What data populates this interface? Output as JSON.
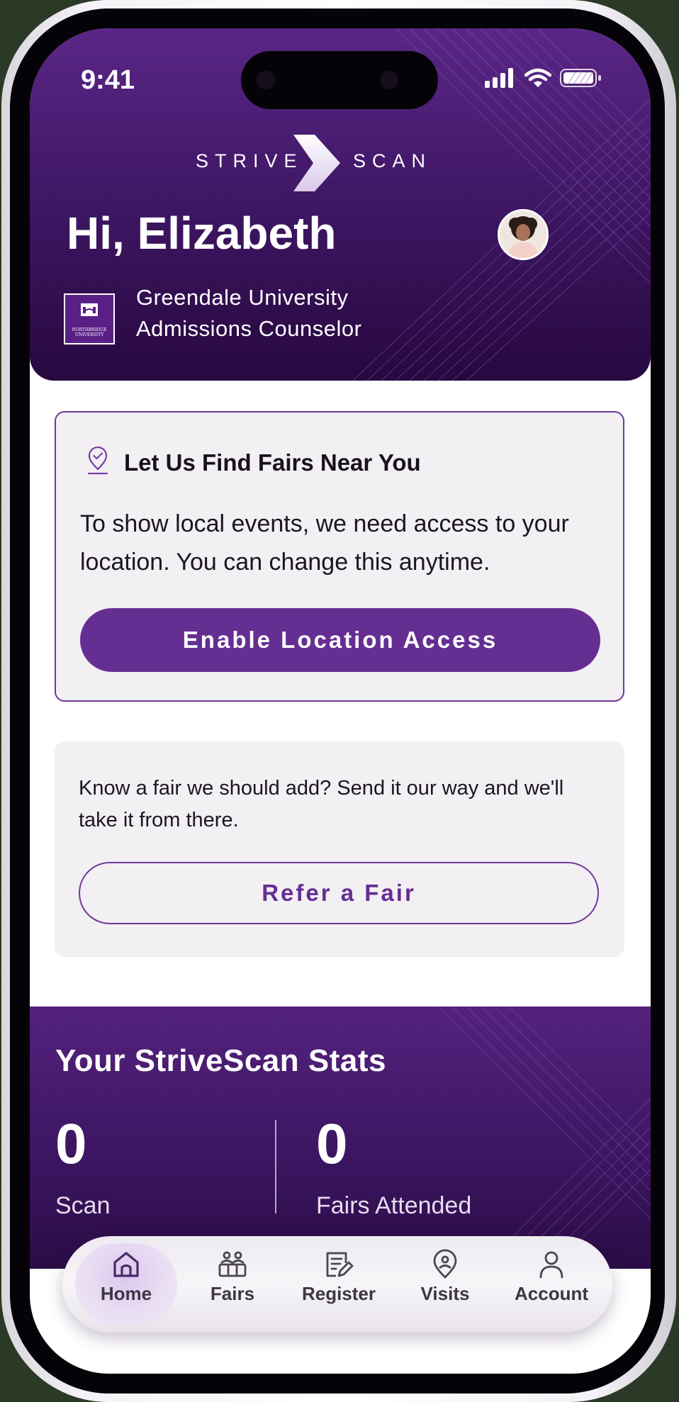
{
  "status_bar": {
    "time": "9:41"
  },
  "brand": {
    "left": "STRIVE",
    "right": "SCAN"
  },
  "header": {
    "greeting": "Hi, Elizabeth",
    "university": "Greendale University",
    "role": "Admissions Counselor",
    "uni_logo_caption": "NORTHBRIDGE UNIVERSITY"
  },
  "location_card": {
    "title": "Let Us Find Fairs Near You",
    "description": "To show local events, we need access to your location. You can change this anytime.",
    "button_label": "Enable Location Access"
  },
  "refer_card": {
    "description": "Know a fair we should add? Send it our way and we'll take it from there.",
    "button_label": "Refer a Fair"
  },
  "stats": {
    "title": "Your StriveScan Stats",
    "scan_value": "0",
    "scan_label": "Scan",
    "fairs_value": "0",
    "fairs_label": "Fairs Attended"
  },
  "nav": {
    "active": "Home",
    "items": [
      {
        "label": "Home",
        "icon": "home-icon"
      },
      {
        "label": "Fairs",
        "icon": "fairs-icon"
      },
      {
        "label": "Register",
        "icon": "register-icon"
      },
      {
        "label": "Visits",
        "icon": "visits-icon"
      },
      {
        "label": "Account",
        "icon": "account-icon"
      }
    ]
  },
  "colors": {
    "primary": "#652e92",
    "header_dark": "#27083f",
    "card_bg": "#f3f0f4"
  }
}
